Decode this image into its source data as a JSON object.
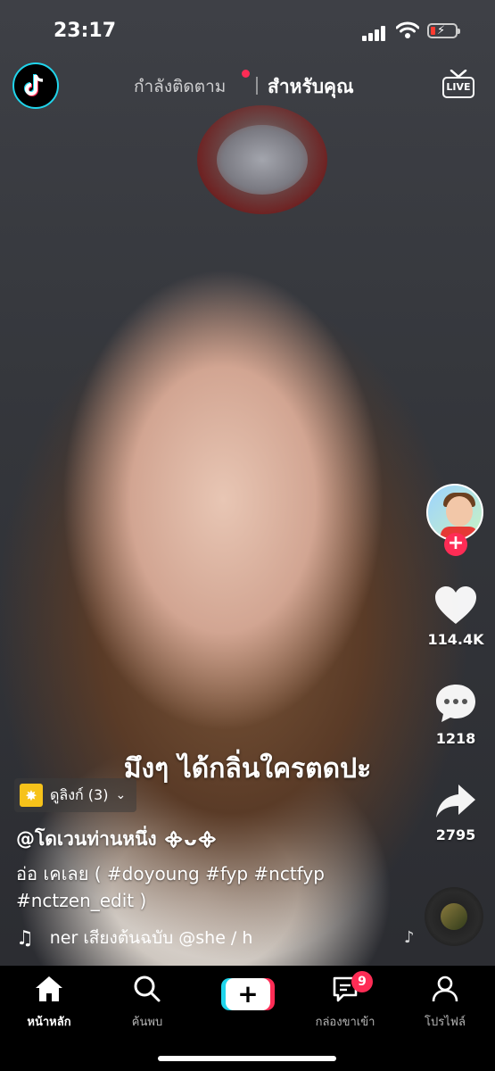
{
  "status_bar": {
    "time": "23:17"
  },
  "top_nav": {
    "following_label": "กำลังติดตาม",
    "for_you_label": "สำหรับคุณ",
    "live_label": "LIVE"
  },
  "video": {
    "caption": "มึงๆ ได้กลิ่นใครตดปะ",
    "related_label": "ดูลิงก์ (3)",
    "username": "@โดเวนท่านหนึ่ง ᯽ᴗ᯽",
    "description": "อ่อ เคเลย ( #doyoung #fyp #nctfyp #nctzen_edit )",
    "music": "ner เสียงต้นฉบับ   @she / h"
  },
  "actions": {
    "likes": "114.4K",
    "comments": "1218",
    "shares": "2795"
  },
  "bottom_nav": {
    "home": "หน้าหลัก",
    "discover": "ค้นพบ",
    "inbox": "กล่องขาเข้า",
    "inbox_badge": "9",
    "profile": "โปรไฟล์"
  },
  "colors": {
    "accent": "#fe2c55",
    "cyan": "#20d5ec"
  }
}
